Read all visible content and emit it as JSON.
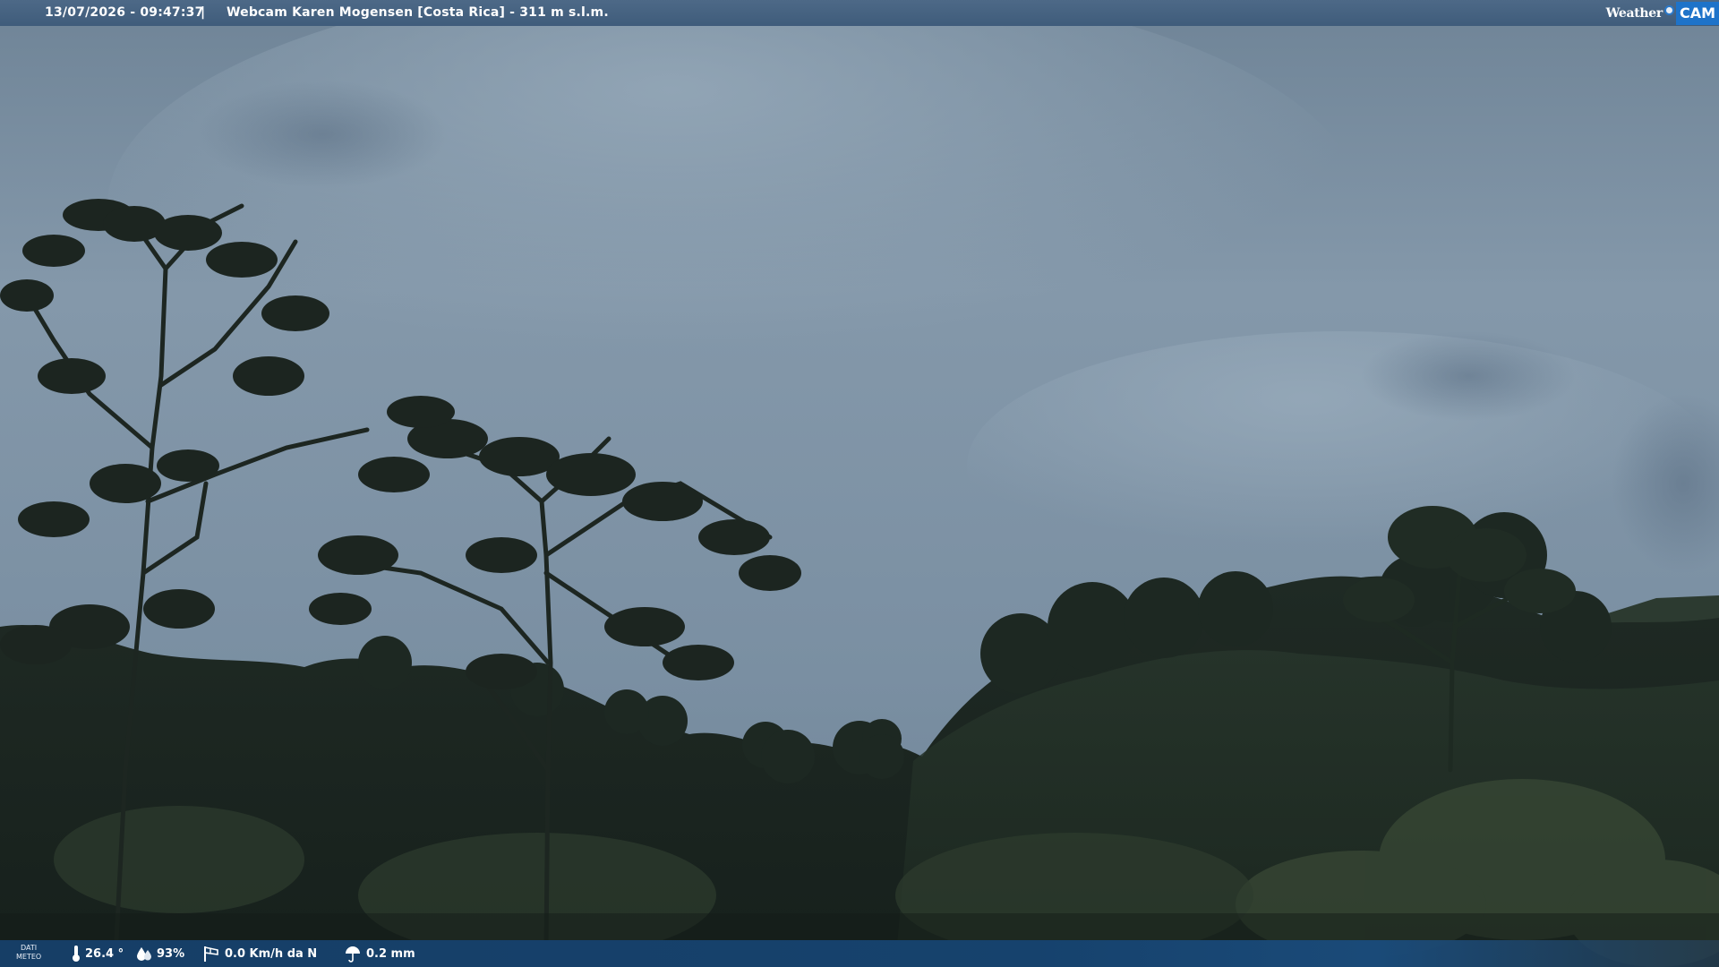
{
  "header": {
    "datetime": "13/07/2026 - 09:47:37",
    "separator": "|",
    "title": "Webcam Karen Mogensen [Costa Rica]  - 311 m s.l.m."
  },
  "logo": {
    "weather_text": "Weather",
    "cam_text": "CAM"
  },
  "footer": {
    "dati_line1": "DATI",
    "dati_line2": "METEO",
    "temperature": "26.4 °",
    "humidity": "93%",
    "wind": "0.0 Km/h da N",
    "rain": "0.2 mm"
  },
  "icons": {
    "temperature": "thermometer-icon",
    "humidity": "humidity-drop-icon",
    "wind": "wind-sock-icon",
    "rain": "rain-umbrella-icon"
  },
  "colors": {
    "top_bar": "#4d6987",
    "bottom_bar": "#163e66",
    "logo_accent": "#1e73c9"
  }
}
